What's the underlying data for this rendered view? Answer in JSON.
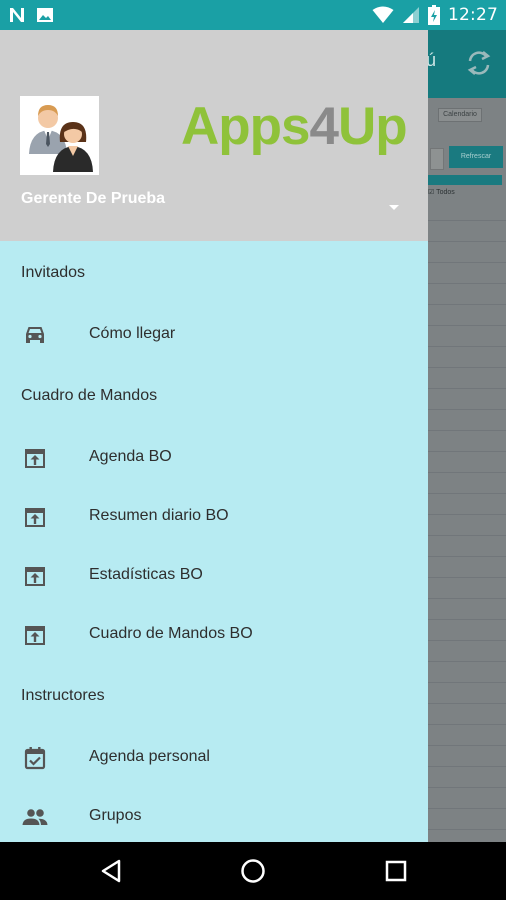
{
  "status_bar": {
    "time": "12:27",
    "left_icons": [
      "n-notification-icon",
      "image-notification-icon"
    ],
    "right_icons": [
      "wifi-icon",
      "signal-icon",
      "battery-icon"
    ],
    "color": "#1aa0a5"
  },
  "background_app": {
    "menu_fragment": "ú",
    "small_button": "Calendario",
    "refresh_button": "Refrescar",
    "check_label": "Todos"
  },
  "drawer": {
    "header": {
      "brand": {
        "part1": "Apps",
        "part2": "4",
        "part3": "Up"
      },
      "user_name": "Gerente De Prueba",
      "background": "#cfcfcf"
    },
    "sections": [
      {
        "title": "Invitados",
        "items": [
          {
            "label": "Cómo llegar",
            "icon": "car-icon"
          }
        ]
      },
      {
        "title": "Cuadro de Mandos",
        "items": [
          {
            "label": "Agenda BO",
            "icon": "open-in-app-icon"
          },
          {
            "label": "Resumen diario BO",
            "icon": "open-in-app-icon"
          },
          {
            "label": "Estadísticas BO",
            "icon": "open-in-app-icon"
          },
          {
            "label": "Cuadro de Mandos BO",
            "icon": "open-in-app-icon"
          }
        ]
      },
      {
        "title": "Instructores",
        "items": [
          {
            "label": "Agenda personal",
            "icon": "calendar-check-icon"
          },
          {
            "label": "Grupos",
            "icon": "group-icon"
          }
        ]
      }
    ],
    "background": "#b7ebf2"
  },
  "nav_bar": {
    "buttons": [
      "back-icon",
      "home-icon",
      "recents-icon"
    ]
  }
}
